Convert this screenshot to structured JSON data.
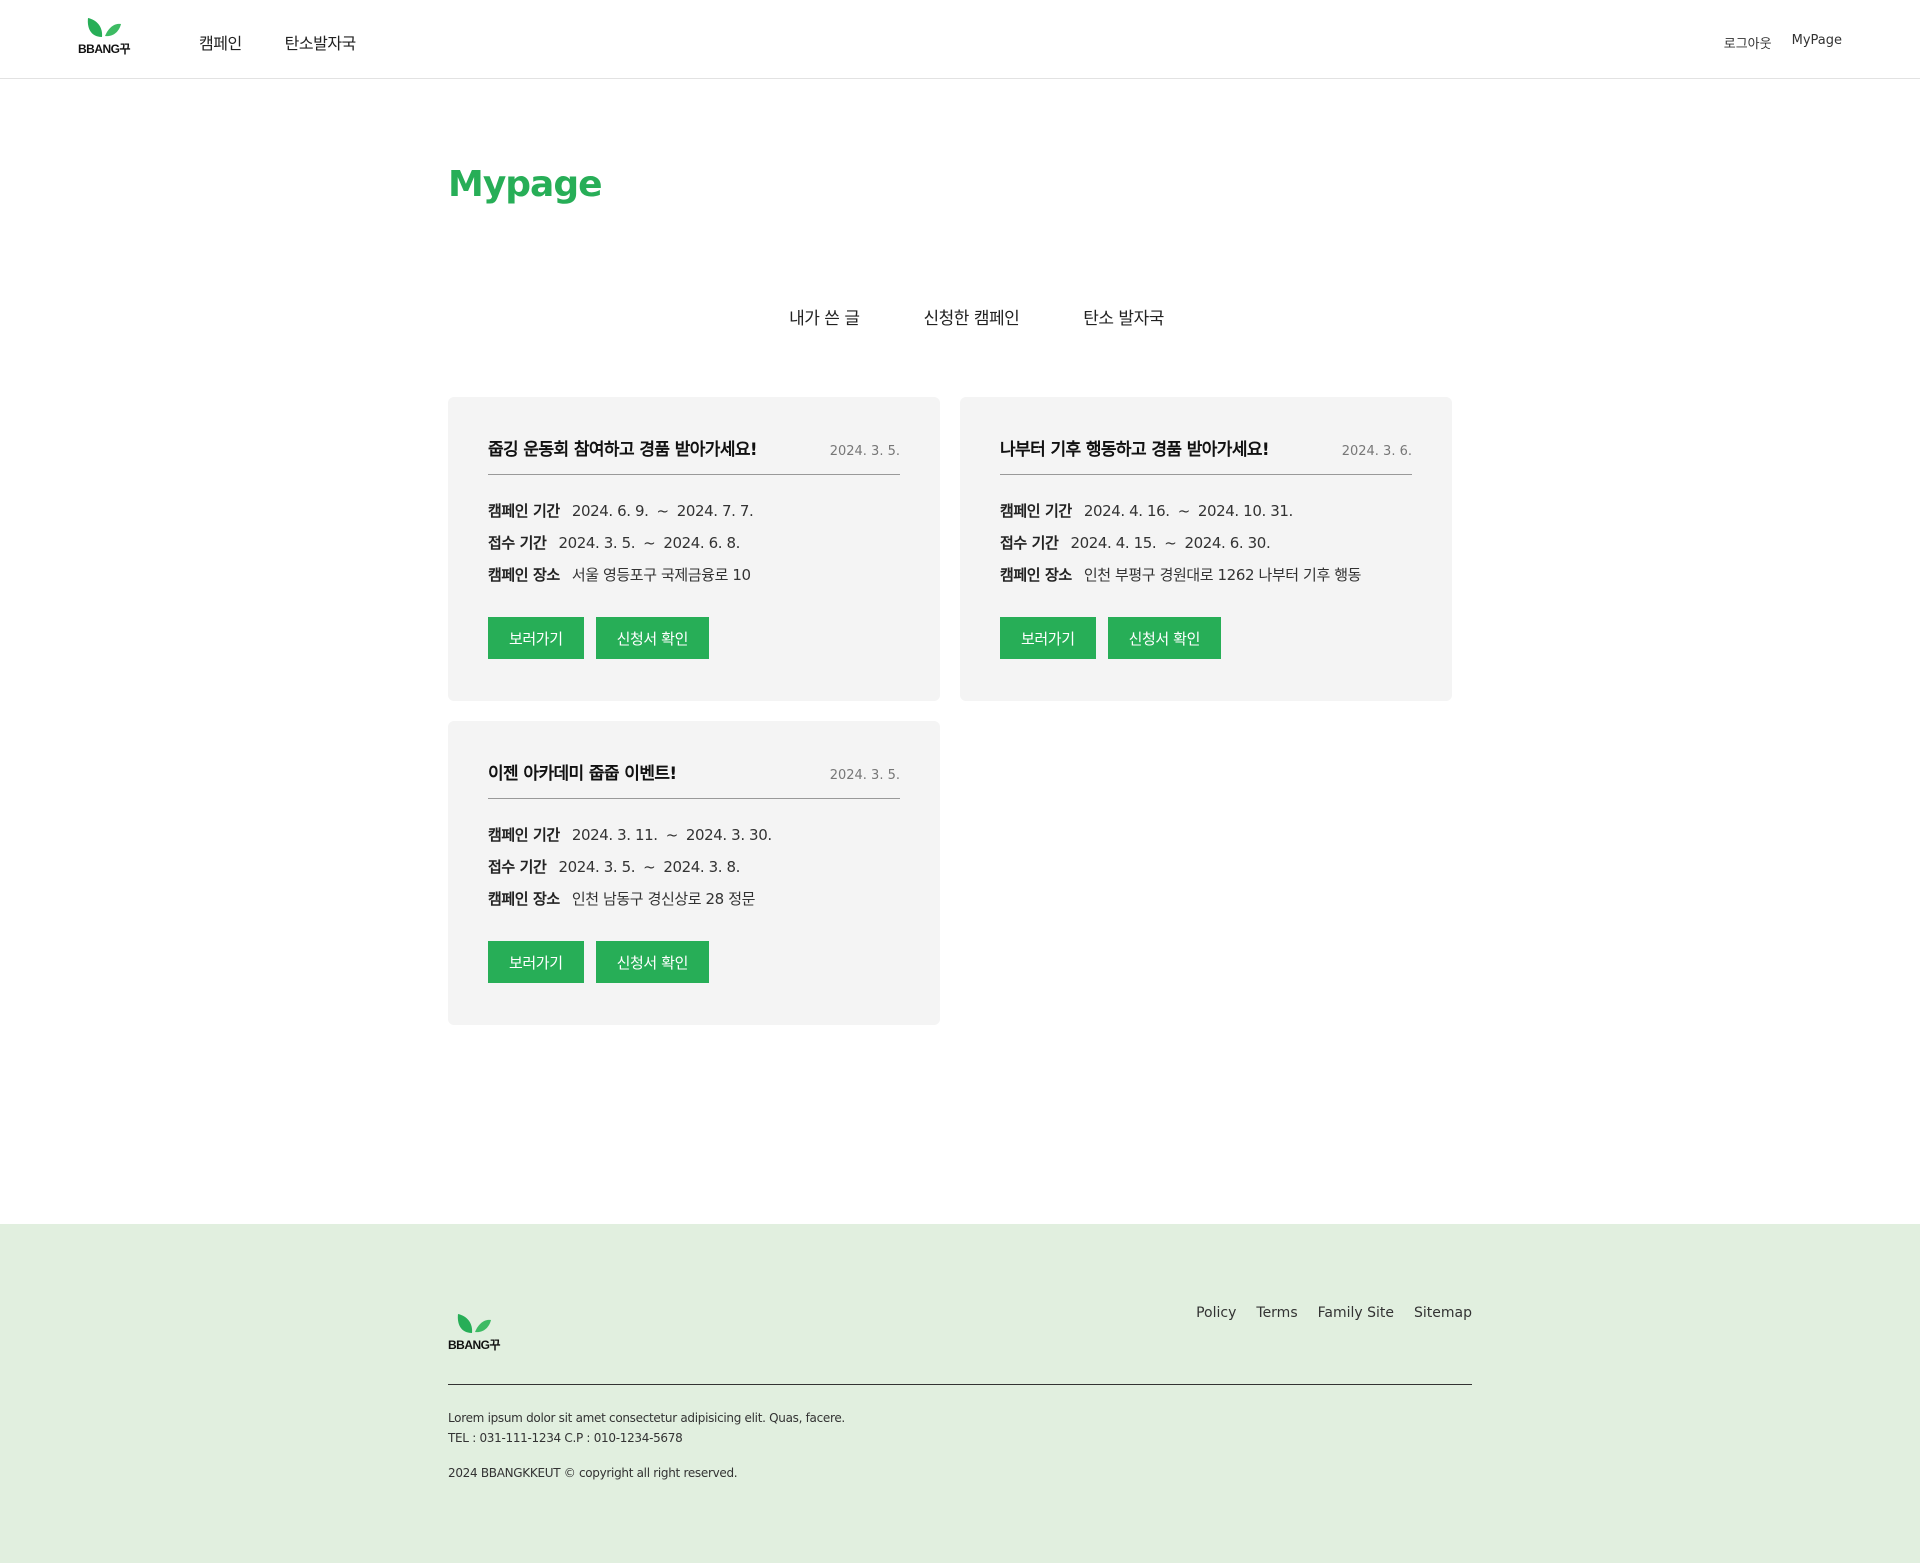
{
  "brand": {
    "name": "BBANG꾸",
    "leaf_color": "#27ae57"
  },
  "header": {
    "nav": [
      "캠페인",
      "탄소발자국"
    ],
    "util": [
      "로그아웃",
      "MyPage"
    ]
  },
  "page": {
    "title": "Mypage"
  },
  "tabs": [
    {
      "label": "내가 쓴 글",
      "active": false
    },
    {
      "label": "신청한 캠페인",
      "active": true
    },
    {
      "label": "탄소 발자국",
      "active": false
    }
  ],
  "labels": {
    "campaign_period": "캠페인 기간",
    "apply_period": "접수 기간",
    "campaign_place": "캠페인 장소",
    "tilde": "~",
    "view_button": "보러가기",
    "application_button": "신청서 확인"
  },
  "cards": [
    {
      "title": "줍깅 운동회 참여하고 경품 받아가세요!",
      "date": "2024. 3. 5.",
      "campaign_start": "2024. 6. 9.",
      "campaign_end": "2024. 7. 7.",
      "apply_start": "2024. 3. 5.",
      "apply_end": "2024. 6. 8.",
      "place": "서울 영등포구 국제금융로 10"
    },
    {
      "title": "나부터 기후 행동하고 경품 받아가세요!",
      "date": "2024. 3. 6.",
      "campaign_start": "2024. 4. 16.",
      "campaign_end": "2024. 10. 31.",
      "apply_start": "2024. 4. 15.",
      "apply_end": "2024. 6. 30.",
      "place": "인천 부평구 경원대로 1262  나부터 기후 행동"
    },
    {
      "title": "이젠 아카데미 줍줍 이벤트!",
      "date": "2024. 3. 5.",
      "campaign_start": "2024. 3. 11.",
      "campaign_end": "2024. 3. 30.",
      "apply_start": "2024. 3. 5.",
      "apply_end": "2024. 3. 8.",
      "place": "인천 남동구 경신상로 28  정문"
    }
  ],
  "footer": {
    "links": [
      "Policy",
      "Terms",
      "Family Site",
      "Sitemap"
    ],
    "description": "Lorem ipsum dolor sit amet consectetur adipisicing elit. Quas, facere.",
    "contact": "TEL : 031-111-1234 C.P : 010-1234-5678",
    "copyright": "2024 BBANGKKEUT © copyright all right reserved."
  },
  "colors": {
    "accent": "#27ae57",
    "card_bg": "#f4f4f4",
    "footer_bg": "#e1efdf",
    "tab_highlight": "#dcefdc"
  }
}
